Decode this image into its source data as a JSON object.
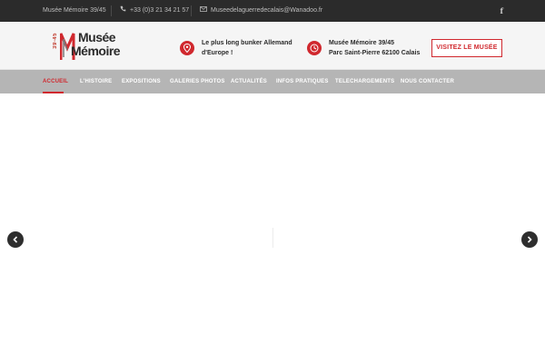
{
  "topbar": {
    "museum_name": "Musée Mémoire 39/45",
    "phone": "+33 (0)3 21 34 21 57",
    "email": "Museedelaguerredecalais@Wanadoo.fr",
    "social": "f"
  },
  "logo": {
    "years": "39-45",
    "line1": "Musée",
    "line2": "Mémoire"
  },
  "header": {
    "info1": {
      "line1": "Le plus long bunker Allemand",
      "line2": "d'Europe !"
    },
    "info2": {
      "line1": "Musée Mémoire 39/45",
      "line2": "Parc Saint-Pierre 62100 Calais"
    },
    "visit_button": "VISITEZ LE MUSÉE"
  },
  "nav": {
    "items": [
      {
        "label": "ACCUEIL"
      },
      {
        "label": "L'HISTOIRE"
      },
      {
        "label": "EXPOSITIONS"
      },
      {
        "label": "GALERIES PHOTOS"
      },
      {
        "label": "ACTUALITÉS"
      },
      {
        "label": "INFOS PRATIQUES"
      },
      {
        "label": "TELECHARGEMENTS"
      },
      {
        "label": "NOUS CONTACTER"
      }
    ],
    "active_index": 0
  },
  "colors": {
    "accent": "#d0282e",
    "topbar_bg": "#2b2b2b",
    "nav_bg": "#b5b5b5"
  }
}
